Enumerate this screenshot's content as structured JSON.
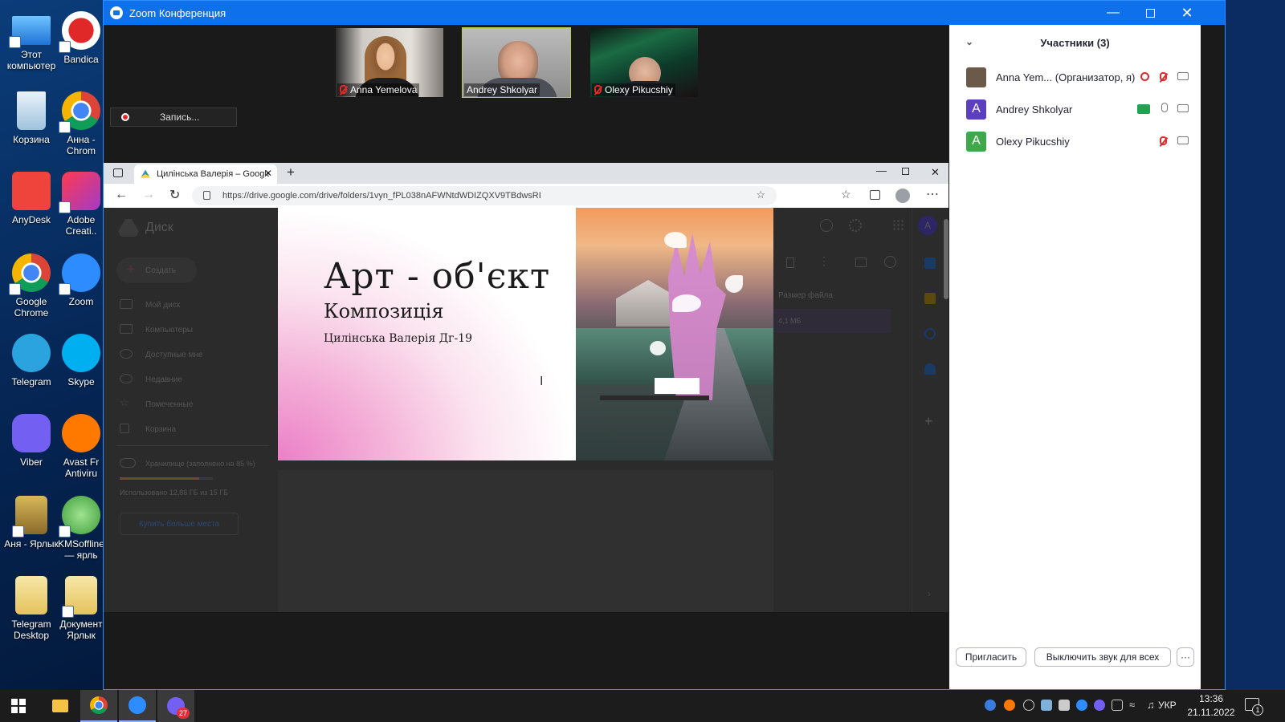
{
  "desktop": {
    "icons": [
      {
        "label": "Этот компьютер"
      },
      {
        "label": "Bandica"
      },
      {
        "label": "Корзина"
      },
      {
        "label": "Анна - Chrom"
      },
      {
        "label": "AnyDesk"
      },
      {
        "label": "Adobe Creati.."
      },
      {
        "label": "Google Chrome"
      },
      {
        "label": "Zoom"
      },
      {
        "label": "Telegram"
      },
      {
        "label": "Skype"
      },
      {
        "label": "Viber"
      },
      {
        "label": "Avast Fr Antiviru"
      },
      {
        "label": "Аня - Ярлык"
      },
      {
        "label": "KMSoffline — ярль"
      },
      {
        "label": "Telegram Desktop"
      },
      {
        "label": "Документ Ярлык"
      }
    ]
  },
  "zoom": {
    "title": "Zoom Конференция",
    "recording_label": "Запись...",
    "videos": [
      {
        "name": "Anna Yemelova",
        "muted": true
      },
      {
        "name": "Andrey Shkolyar",
        "muted": false,
        "active": true
      },
      {
        "name": "Olexy Pikucshiy",
        "muted": true
      }
    ],
    "participants_title": "Участники (3)",
    "participants": [
      {
        "name": "Anna Yem...",
        "role": "(Организатор, я)",
        "avatar": "",
        "avatar_color": "#6b5a4a",
        "muted": true
      },
      {
        "name": "Andrey Shkolyar",
        "role": "",
        "avatar": "A",
        "avatar_color": "#5b3fbf",
        "muted": false,
        "sharing": true
      },
      {
        "name": "Olexy Pikucshiy",
        "role": "",
        "avatar": "A",
        "avatar_color": "#3fa84a",
        "muted": true
      }
    ],
    "invite_label": "Пригласить",
    "mute_all_label": "Выключить звук для всех",
    "more_label": "···"
  },
  "browser": {
    "tab_title": "Цилінська Валерія – Google Д",
    "url": "https://drive.google.com/drive/folders/1vyn_fPL038nAFWNtdWDIZQXV9TBdwsRI",
    "drive": {
      "logo_text": "Диск",
      "create_label": "Создать",
      "nav": [
        "Мой диск",
        "Компьютеры",
        "Доступные мне",
        "Недавние",
        "Помеченные",
        "Корзина"
      ],
      "storage_label": "Хранилище (заполнено на 85 %)",
      "storage_fraction": 0.85,
      "storage_used": "Использовано 12,86 ГБ из 15 ГБ",
      "buy_label": "Купить больше места",
      "col_header": "Размер файла",
      "file_size": "4,1 МБ"
    }
  },
  "slide": {
    "title": "Арт - об'єкт",
    "subtitle": "Композиція",
    "author": "Цилінська Валерія Дг-19"
  },
  "taskbar": {
    "lang": "УКР",
    "time": "13:36",
    "date": "21.11.2022",
    "viber_badge": "27",
    "notif_count": "1"
  },
  "colors": {
    "zoom_blue": "#0e71eb",
    "active_speaker": "#b5d334",
    "muted_red": "#e02828"
  }
}
